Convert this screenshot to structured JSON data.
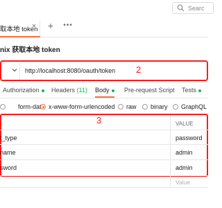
{
  "search": {
    "placeholder": "Searc"
  },
  "tabs": [
    {
      "title": "取本地 token",
      "close_glyph": "×"
    }
  ],
  "tab_actions": {
    "add": "+",
    "more": "•••"
  },
  "request": {
    "name": "nix 获取本地 token",
    "url": "http://localhost:8080/oauth/token"
  },
  "annotations": {
    "url_box": "2",
    "table_box": "3"
  },
  "request_tabs": [
    {
      "label": "Authorization",
      "dot": true
    },
    {
      "label": "Headers",
      "count": "(11)"
    },
    {
      "label": "Body",
      "dot": true,
      "active": true
    },
    {
      "label": "Pre-request Script"
    },
    {
      "label": "Tests",
      "dot": true
    }
  ],
  "body_types": [
    {
      "label": "form-data",
      "selected": false
    },
    {
      "label": "x-www-form-urlencoded",
      "selected": true
    },
    {
      "label": "raw",
      "selected": false
    },
    {
      "label": "binary",
      "selected": false
    },
    {
      "label": "GraphQL",
      "selected": false
    }
  ],
  "params_table": {
    "value_header": "VALUE",
    "rows": [
      {
        "key": "t_type",
        "value": "password"
      },
      {
        "key": "name",
        "value": "admin"
      },
      {
        "key": "sword",
        "value": "admin"
      }
    ],
    "new_value_placeholder": "Value"
  },
  "colors": {
    "accent": "#ff6c37",
    "annotation": "#ff1a1a",
    "status_dot": "#0cbb52"
  }
}
